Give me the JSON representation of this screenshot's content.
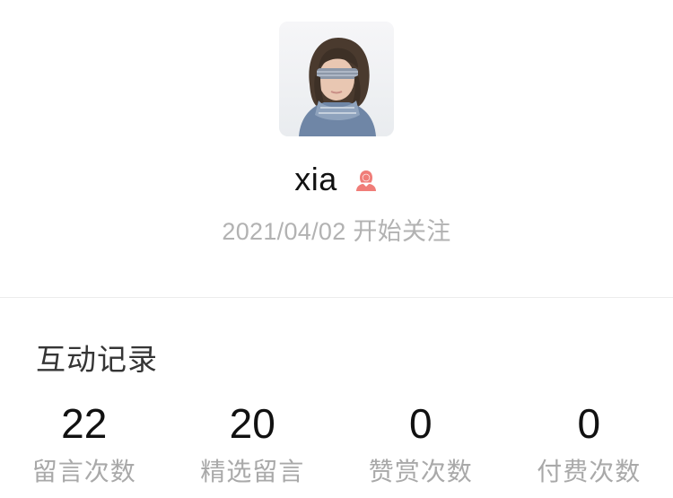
{
  "profile": {
    "avatar_icon": "user-avatar-photo",
    "name": "xia",
    "gender_icon": "female-user-icon",
    "gender_color": "#f07d78",
    "follow_date": "2021/04/02 开始关注"
  },
  "interaction": {
    "title": "互动记录",
    "stats": [
      {
        "value": "22",
        "label": "留言次数"
      },
      {
        "value": "20",
        "label": "精选留言"
      },
      {
        "value": "0",
        "label": "赞赏次数"
      },
      {
        "value": "0",
        "label": "付费次数"
      }
    ]
  }
}
